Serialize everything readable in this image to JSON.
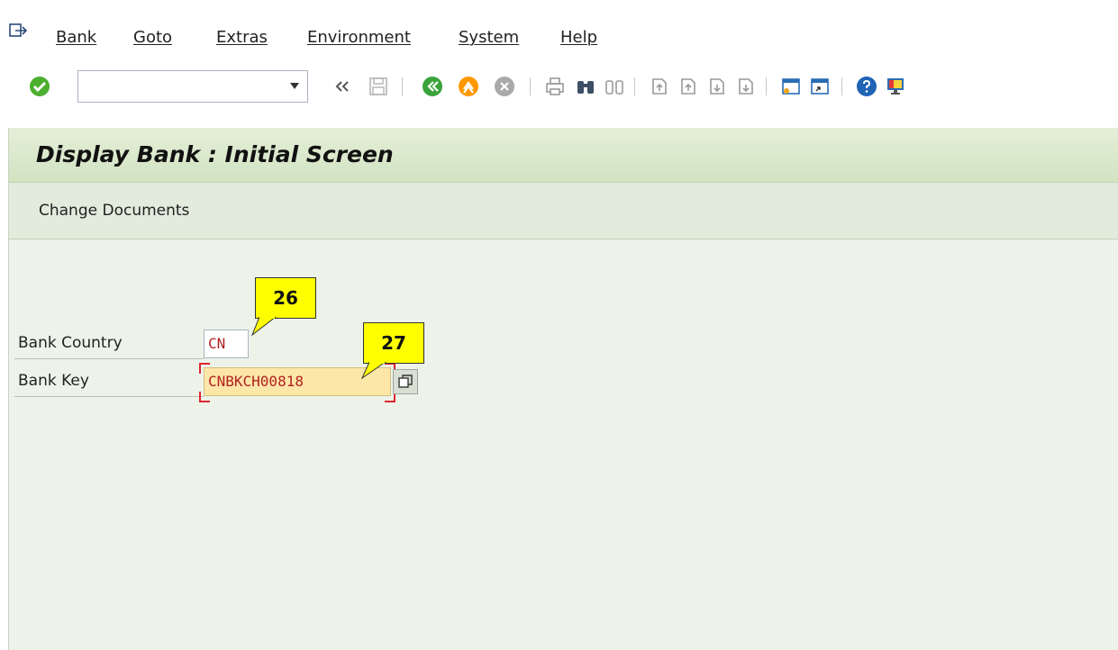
{
  "menu": {
    "items": [
      "Bank",
      "Goto",
      "Extras",
      "Environment",
      "System",
      "Help"
    ]
  },
  "toolbar": {
    "command_field_value": "",
    "icons": [
      "enter-check-icon",
      "back-double-chevron-icon",
      "save-icon",
      "back-icon",
      "exit-icon",
      "cancel-icon",
      "print-icon",
      "find-icon",
      "find-next-icon",
      "first-page-icon",
      "previous-page-icon",
      "next-page-icon",
      "last-page-icon",
      "create-session-icon",
      "shortcut-icon",
      "help-icon",
      "customize-layout-icon"
    ],
    "colors": {
      "enter": "#4caf2f",
      "back": "#3aa33a",
      "exit": "#ff9800",
      "cancel": "#a9a9a9",
      "help": "#1f63b5"
    }
  },
  "screen": {
    "title": "Display Bank : Initial Screen",
    "app_toolbar": {
      "change_documents_label": "Change Documents"
    },
    "form": {
      "bank_country_label": "Bank Country",
      "bank_country_value": "CN",
      "bank_key_label": "Bank Key",
      "bank_key_value": "CNBKCH00818"
    }
  },
  "callouts": {
    "first": "26",
    "second": "27"
  }
}
